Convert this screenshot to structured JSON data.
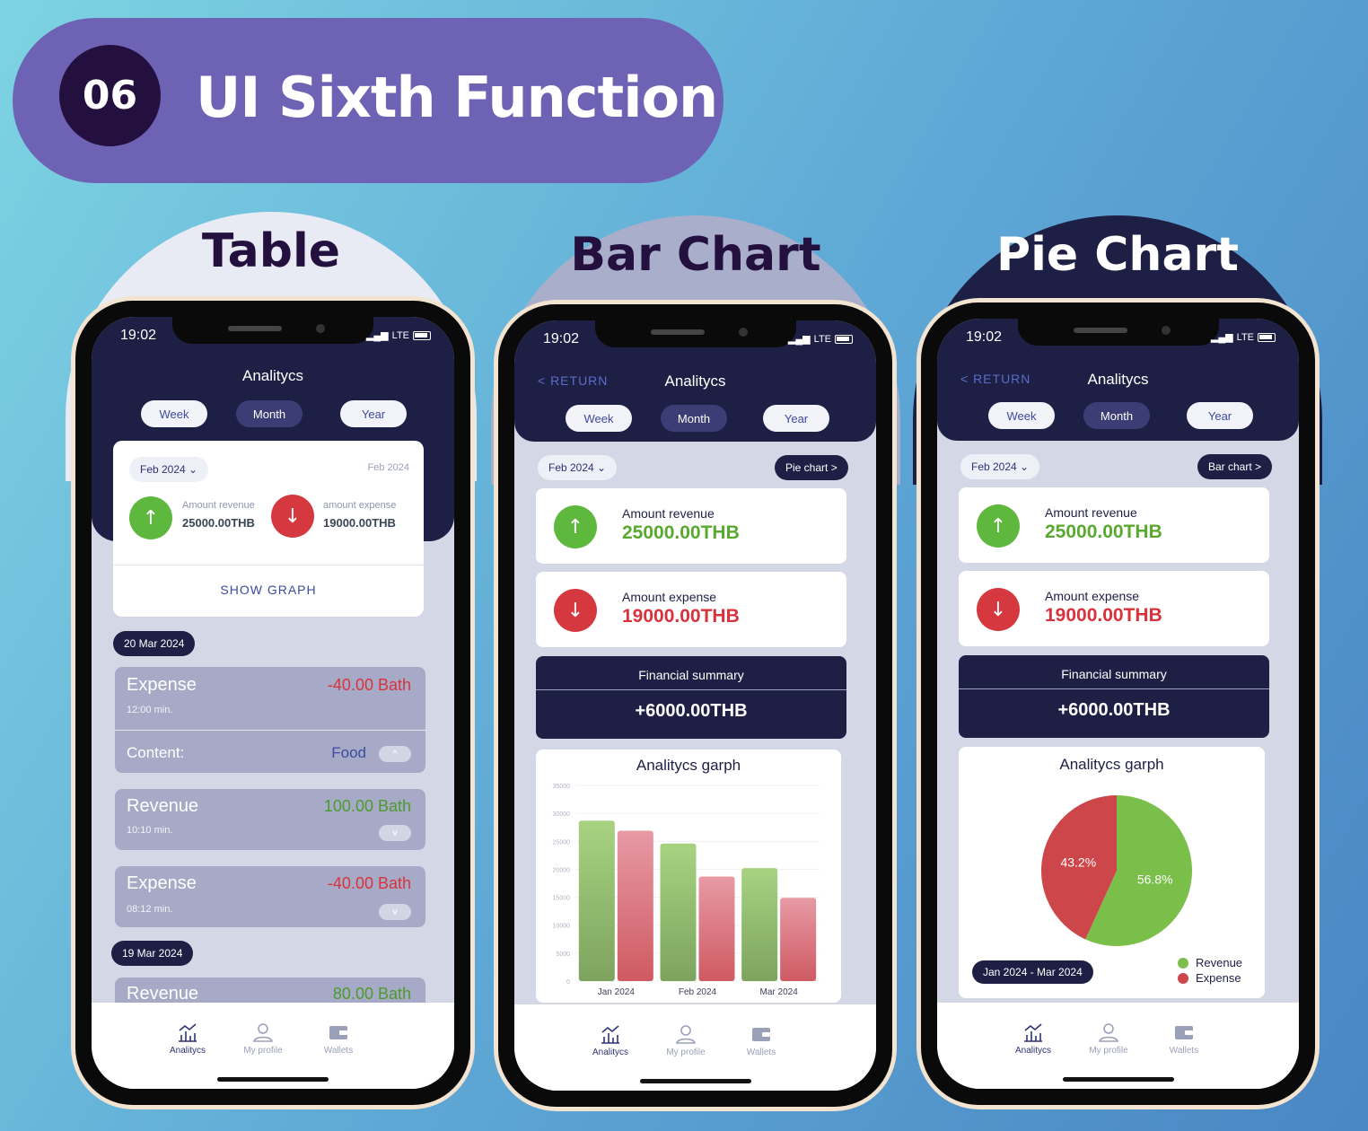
{
  "banner": {
    "number": "06",
    "title": "UI Sixth Function"
  },
  "sections": {
    "table": "Table",
    "bar": "Bar Chart",
    "pie": "Pie Chart"
  },
  "status": {
    "time": "19:02",
    "network": "LTE"
  },
  "header": {
    "title": "Analitycs",
    "return": "< RETURN"
  },
  "periods": {
    "week": "Week",
    "month": "Month",
    "year": "Year",
    "selected": "Month"
  },
  "table_screen": {
    "month_chip": "Feb 2024 ⌄",
    "month_right": "Feb 2024",
    "revenue_label": "Amount revenue",
    "revenue_value": "25000.00THB",
    "expense_label": "amount expense",
    "expense_value": "19000.00THB",
    "show_graph": "SHOW GRAPH",
    "groups": [
      {
        "date": "20 Mar 2024",
        "items": [
          {
            "kind": "Expense",
            "amount": "-40.00 Bath",
            "time": "12:00 min.",
            "content_label": "Content:",
            "content_value": "Food",
            "toggle": "^"
          },
          {
            "kind": "Revenue",
            "amount": "100.00 Bath",
            "time": "10:10 min.",
            "toggle": "v"
          },
          {
            "kind": "Expense",
            "amount": "-40.00 Bath",
            "time": "08:12 min.",
            "toggle": "v"
          }
        ]
      },
      {
        "date": "19 Mar 2024",
        "items": [
          {
            "kind": "Revenue",
            "amount": "80.00 Bath"
          }
        ]
      }
    ]
  },
  "bar_screen": {
    "month_chip": "Feb 2024 ⌄",
    "switch_button": "Pie chart >",
    "revenue_label": "Amount revenue",
    "revenue_value": "25000.00THB",
    "expense_label": "Amount expense",
    "expense_value": "19000.00THB",
    "summary_title": "Financial summary",
    "summary_value": "+6000.00THB",
    "graph_title": "Analitycs garph"
  },
  "pie_screen": {
    "month_chip": "Feb 2024 ⌄",
    "switch_button": "Bar chart >",
    "revenue_label": "Amount revenue",
    "revenue_value": "25000.00THB",
    "expense_label": "Amount expense",
    "expense_value": "19000.00THB",
    "summary_title": "Financial summary",
    "summary_value": "+6000.00THB",
    "graph_title": "Analitycs garph",
    "range_chip": "Jan 2024 - Mar 2024"
  },
  "chart_data": [
    {
      "type": "bar",
      "title": "Analitycs garph",
      "categories": [
        "Jan 2024",
        "Feb 2024",
        "Mar 2024"
      ],
      "series": [
        {
          "values": [
            28700,
            26900,
            24600,
            18700,
            20200,
            14900
          ]
        }
      ],
      "series_colors": [
        "#a7d381",
        "#e79aa5"
      ],
      "ylim": [
        0,
        35000
      ],
      "yticks": [
        0,
        5000,
        10000,
        15000,
        20000,
        25000,
        30000,
        35000
      ],
      "grid": true
    },
    {
      "type": "pie",
      "title": "Analitycs garph",
      "categories": [
        "Revenue",
        "Expense"
      ],
      "values": [
        56.8,
        43.2
      ],
      "labels": [
        "56.8%",
        "43.2%"
      ],
      "colors": [
        "#7bbf4b",
        "#cd4649"
      ],
      "legend": "bottom-right"
    }
  ],
  "nav": {
    "analytics": "Analitycs",
    "profile": "My profile",
    "wallets": "Wallets"
  },
  "colors": {
    "navy": "#1e1f45",
    "accent": "#3d4aa0",
    "revenue": "#5fb83e",
    "expense": "#d63840"
  }
}
